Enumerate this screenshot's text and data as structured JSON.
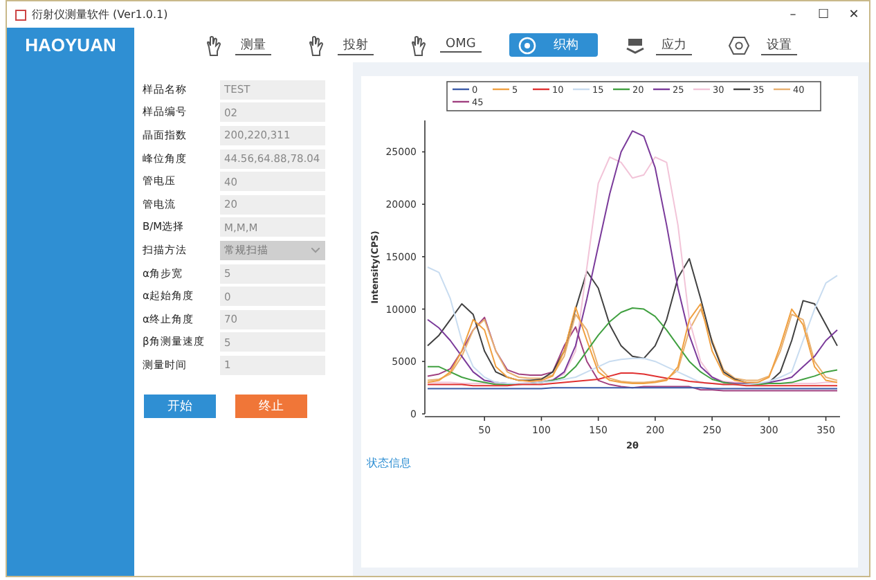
{
  "window": {
    "title": "衍射仪测量软件 (Ver1.0.1)",
    "controls": [
      "–",
      "☐",
      "✕"
    ]
  },
  "logo": "HAOYUAN",
  "tabs": [
    {
      "label": "测量",
      "selected": false
    },
    {
      "label": "投射",
      "selected": false
    },
    {
      "label": "OMG",
      "selected": false
    },
    {
      "label": "织构",
      "selected": true
    },
    {
      "label": "应力",
      "selected": false
    },
    {
      "label": "设置",
      "selected": false
    }
  ],
  "form": [
    {
      "label": "样品名称",
      "value": "TEST",
      "kind": "text"
    },
    {
      "label": "样品编号",
      "value": "02",
      "kind": "text"
    },
    {
      "label": "晶面指数",
      "value": "200,220,311",
      "kind": "text"
    },
    {
      "label": "峰位角度",
      "value": "44.56,64.88,78.04",
      "kind": "text"
    },
    {
      "label": "管电压",
      "value": "40",
      "kind": "text"
    },
    {
      "label": "管电流",
      "value": "20",
      "kind": "text"
    },
    {
      "label": "B/M选择",
      "value": "M,M,M",
      "kind": "text"
    },
    {
      "label": "扫描方法",
      "value": "常规扫描",
      "kind": "select"
    },
    {
      "label": "α角步宽",
      "value": "5",
      "kind": "text"
    },
    {
      "label": "α起始角度",
      "value": "0",
      "kind": "text"
    },
    {
      "label": "α终止角度",
      "value": "70",
      "kind": "text"
    },
    {
      "label": "β角测量速度",
      "value": "5",
      "kind": "text"
    },
    {
      "label": "测量时间",
      "value": "1",
      "kind": "text"
    }
  ],
  "buttons": [
    {
      "label": "开始",
      "kind": "start"
    },
    {
      "label": "终止",
      "kind": "stop"
    }
  ],
  "status_label": "状态信息",
  "chart_data": {
    "type": "line",
    "xlabel": "2θ",
    "ylabel": "Intensity(CPS)",
    "x": [
      0,
      10,
      20,
      30,
      40,
      50,
      60,
      70,
      80,
      90,
      100,
      110,
      120,
      130,
      140,
      150,
      160,
      170,
      180,
      190,
      200,
      210,
      220,
      230,
      240,
      250,
      260,
      270,
      280,
      290,
      300,
      310,
      320,
      330,
      340,
      350,
      360
    ],
    "legend": "top",
    "xlim": [
      0,
      360
    ],
    "ylim": [
      0,
      28000
    ],
    "xticks": [
      50,
      100,
      150,
      200,
      250,
      300,
      350
    ],
    "yticks": [
      0,
      5000,
      10000,
      15000,
      20000,
      25000
    ],
    "series": [
      {
        "name": "0",
        "color": "#3a5aa8",
        "values": [
          2400,
          2400,
          2400,
          2400,
          2400,
          2400,
          2400,
          2400,
          2400,
          2400,
          2400,
          2500,
          2500,
          2500,
          2500,
          2500,
          2500,
          2500,
          2500,
          2500,
          2500,
          2500,
          2500,
          2500,
          2500,
          2400,
          2400,
          2400,
          2400,
          2400,
          2400,
          2400,
          2400,
          2400,
          2400,
          2400,
          2400
        ]
      },
      {
        "name": "5",
        "color": "#f0a040",
        "values": [
          3000,
          3200,
          4000,
          6000,
          9000,
          8000,
          4500,
          3500,
          3200,
          3100,
          3200,
          3600,
          6000,
          10200,
          7000,
          4000,
          3200,
          3000,
          2900,
          2900,
          3000,
          3200,
          4500,
          9000,
          10500,
          6000,
          3800,
          3200,
          3000,
          3000,
          3500,
          6500,
          10000,
          8500,
          4500,
          3200,
          3000
        ]
      },
      {
        "name": "10",
        "color": "#e03030",
        "values": [
          2800,
          2800,
          2800,
          2800,
          2700,
          2700,
          2700,
          2700,
          2800,
          2800,
          2800,
          2900,
          3000,
          3100,
          3200,
          3300,
          3600,
          3900,
          3900,
          3800,
          3600,
          3400,
          3300,
          3100,
          3000,
          2900,
          2800,
          2800,
          2700,
          2700,
          2700,
          2700,
          2700,
          2700,
          2700,
          2700,
          2700
        ]
      },
      {
        "name": "15",
        "color": "#c8dcf0",
        "values": [
          14000,
          13500,
          11000,
          7000,
          4500,
          3500,
          3000,
          2900,
          2900,
          2900,
          3000,
          3100,
          3300,
          3500,
          4000,
          4500,
          5000,
          5200,
          5300,
          5300,
          5000,
          4500,
          4000,
          3500,
          3000,
          2900,
          2800,
          2800,
          2800,
          2900,
          3100,
          3500,
          4000,
          7000,
          10000,
          12500,
          13200
        ]
      },
      {
        "name": "20",
        "color": "#40a040",
        "values": [
          4500,
          4500,
          4000,
          3500,
          3200,
          3000,
          2800,
          2800,
          2800,
          2900,
          3000,
          3200,
          3500,
          4500,
          6000,
          7500,
          8800,
          9700,
          10100,
          10000,
          9300,
          8000,
          6500,
          5000,
          4000,
          3300,
          3000,
          2800,
          2800,
          2800,
          2900,
          2900,
          3000,
          3300,
          3600,
          4000,
          4200
        ]
      },
      {
        "name": "25",
        "color": "#7a3a9a",
        "values": [
          9000,
          8200,
          7000,
          5500,
          4000,
          3200,
          3000,
          2900,
          2900,
          2900,
          3000,
          3200,
          4000,
          6500,
          11000,
          16000,
          21000,
          25000,
          27000,
          26500,
          23500,
          18000,
          12000,
          7500,
          4500,
          3500,
          3000,
          2900,
          2900,
          2900,
          3000,
          3200,
          3500,
          4500,
          5500,
          7000,
          8000
        ]
      },
      {
        "name": "30",
        "color": "#f2c4d8",
        "values": [
          3000,
          3000,
          3000,
          2900,
          2900,
          2900,
          2900,
          2900,
          2900,
          3000,
          3100,
          3300,
          3800,
          6000,
          14000,
          22000,
          24500,
          24000,
          22500,
          22800,
          24500,
          24000,
          18000,
          9000,
          5000,
          3500,
          3100,
          3000,
          2900,
          2900,
          2900,
          2900,
          2900,
          2900,
          2900,
          3000,
          3000
        ]
      },
      {
        "name": "35",
        "color": "#404040",
        "values": [
          6500,
          7500,
          9000,
          10500,
          9500,
          6000,
          4000,
          3500,
          3200,
          3200,
          3300,
          4000,
          6000,
          10000,
          13600,
          12000,
          8500,
          6500,
          5500,
          5300,
          6500,
          9000,
          13000,
          14800,
          11000,
          6800,
          4000,
          3300,
          3000,
          null,
          3000,
          4000,
          7000,
          10800,
          10500,
          8500,
          6500
        ]
      },
      {
        "name": "40",
        "color": "#e8b070",
        "values": [
          3200,
          3300,
          3800,
          5500,
          8000,
          9000,
          6000,
          4000,
          3500,
          3400,
          3400,
          3700,
          5500,
          9500,
          8000,
          4500,
          3400,
          3100,
          3000,
          3000,
          3100,
          3300,
          4200,
          8000,
          10000,
          7000,
          4200,
          3400,
          3200,
          3200,
          3600,
          6000,
          9500,
          9000,
          5000,
          3500,
          3200
        ]
      },
      {
        "name": "45",
        "color": "#a04080",
        "values": [
          3600,
          3800,
          4300,
          6000,
          8000,
          9200,
          6000,
          4200,
          3800,
          3700,
          3700,
          4000,
          6500,
          8300,
          5000,
          3200,
          2800,
          2600,
          2500,
          2600,
          2600,
          2600,
          2600,
          2600,
          2300,
          2300,
          2200,
          2200,
          2200,
          2200,
          2200,
          2200,
          2200,
          2200,
          2200,
          2200,
          2200
        ]
      }
    ]
  }
}
